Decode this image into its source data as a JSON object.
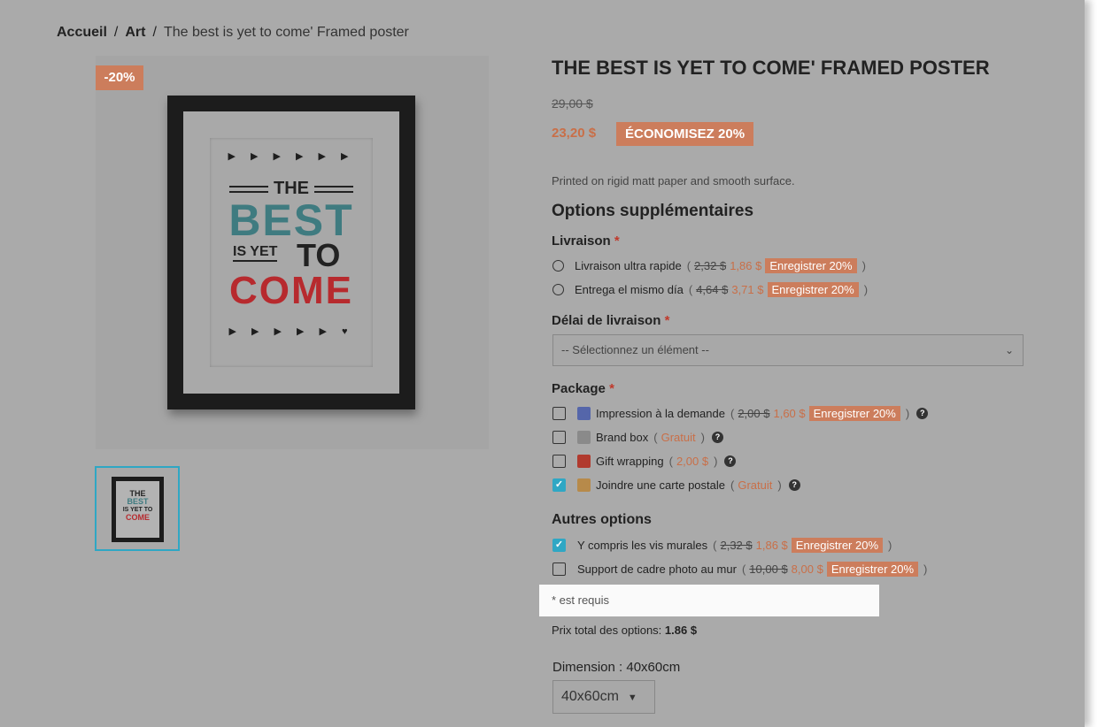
{
  "breadcrumb": {
    "home": "Accueil",
    "sep1": "/",
    "category": "Art",
    "sep2": "/",
    "current": "The best is yet to come' Framed poster"
  },
  "image": {
    "discount_flag": "-20%",
    "art_arrows_top": "▶ ▶ ▶ ▶ ▶ ▶",
    "art_the": "THE",
    "art_best": "BEST",
    "art_isyet": "IS YET",
    "art_to": "TO",
    "art_come": "COME",
    "art_arrows_bottom": "▶ ▶ ▶ ▶ ▶ ♥",
    "thumb_the": "THE",
    "thumb_best": "BEST",
    "thumb_to": "IS YET TO",
    "thumb_come": "COME"
  },
  "product": {
    "title": "THE BEST IS YET TO COME' FRAMED POSTER",
    "old_price": "29,00 $",
    "new_price": "23,20 $",
    "save_badge": "ÉCONOMISEZ 20%",
    "description": "Printed on rigid matt paper and smooth surface."
  },
  "options": {
    "heading": "Options supplémentaires",
    "required_mark": "*",
    "livraison": {
      "label": "Livraison",
      "items": [
        {
          "name": "Livraison ultra rapide",
          "open": "(",
          "old": "2,32 $",
          "new": "1,86 $",
          "tag": "Enregistrer 20%",
          "close": ")"
        },
        {
          "name": "Entrega el mismo día",
          "open": "(",
          "old": "4,64 $",
          "new": "3,71 $",
          "tag": "Enregistrer 20%",
          "close": ")"
        }
      ]
    },
    "delai": {
      "label": "Délai de livraison",
      "placeholder": "-- Sélectionnez un élément --"
    },
    "package": {
      "label": "Package",
      "items": [
        {
          "name": "Impression à la demande",
          "open": "(",
          "old": "2,00 $",
          "new": "1,60 $",
          "tag": "Enregistrer 20%",
          "close": ")",
          "checked": false,
          "icon": "printer-icon"
        },
        {
          "name": "Brand box",
          "open": "(",
          "new": "Gratuit",
          "close": ")",
          "checked": false,
          "icon": "box-icon"
        },
        {
          "name": "Gift wrapping",
          "open": "(",
          "new": "2,00 $",
          "close": ")",
          "checked": false,
          "icon": "gift-icon"
        },
        {
          "name": "Joindre une carte postale",
          "open": "(",
          "new": "Gratuit",
          "close": ")",
          "checked": true,
          "icon": "postcard-icon"
        }
      ]
    },
    "autres": {
      "label": "Autres options",
      "items": [
        {
          "name": "Y compris les vis murales",
          "open": "(",
          "old": "2,32 $",
          "new": "1,86 $",
          "tag": "Enregistrer 20%",
          "close": ")",
          "checked": true
        },
        {
          "name": "Support de cadre photo au mur",
          "open": "(",
          "old": "10,00 $",
          "new": "8,00 $",
          "tag": "Enregistrer 20%",
          "close": ")",
          "checked": false
        }
      ]
    },
    "required_note": "* est requis",
    "total_label": "Prix total des options:",
    "total_value": "1.86 $"
  },
  "dimension": {
    "label": "Dimension : 40x60cm",
    "selected": "40x60cm"
  },
  "colors": {
    "accent": "#cc7d5c",
    "sale_text": "#c96f48",
    "checkbox_checked": "#2fa7c4",
    "overlay_bg": "#aaaaaa",
    "art_teal": "#3f7b80",
    "art_red": "#b72a2e"
  }
}
